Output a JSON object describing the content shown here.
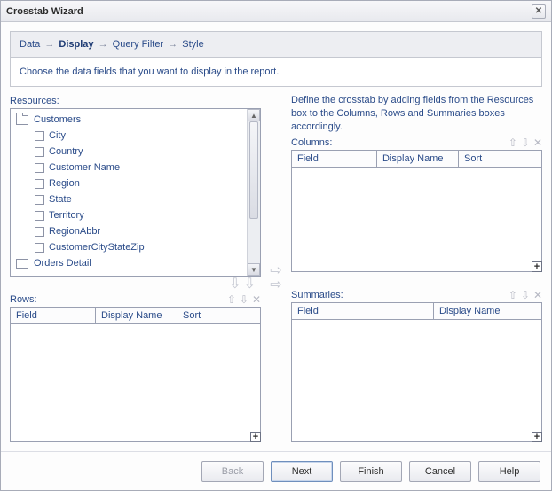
{
  "window": {
    "title": "Crosstab Wizard"
  },
  "breadcrumb": {
    "data": "Data",
    "display": "Display",
    "query_filter": "Query Filter",
    "style": "Style"
  },
  "instruction": "Choose the data fields that you want to display in the report.",
  "resources": {
    "label": "Resources:",
    "root": "Customers",
    "items": [
      "City",
      "Country",
      "Customer Name",
      "Region",
      "State",
      "Territory",
      "RegionAbbr",
      "CustomerCityStateZip"
    ],
    "root2": "Orders Detail"
  },
  "define_text": "Define the crosstab by adding fields from the Resources box to the Columns, Rows and Summaries boxes accordingly.",
  "columns": {
    "label": "Columns:",
    "headers": {
      "field": "Field",
      "display_name": "Display Name",
      "sort": "Sort"
    }
  },
  "rows": {
    "label": "Rows:",
    "headers": {
      "field": "Field",
      "display_name": "Display Name",
      "sort": "Sort"
    }
  },
  "summaries": {
    "label": "Summaries:",
    "headers": {
      "field": "Field",
      "display_name": "Display Name"
    }
  },
  "buttons": {
    "back": "Back",
    "next": "Next",
    "finish": "Finish",
    "cancel": "Cancel",
    "help": "Help"
  },
  "icons": {
    "close": "✕",
    "arrow_right": "➔",
    "arrow_down": "⇩",
    "move_up": "⇧",
    "move_down": "⇩",
    "remove": "✕",
    "plus": "+"
  }
}
